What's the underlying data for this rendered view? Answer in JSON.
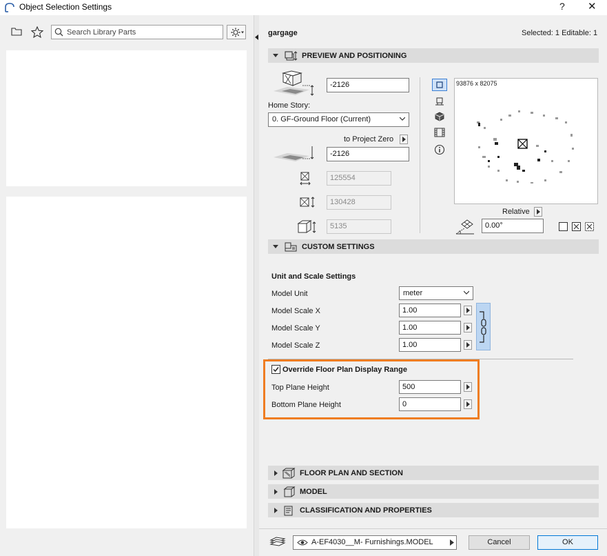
{
  "window": {
    "title": "Object Selection Settings",
    "help_glyph": "?",
    "close_glyph": "✕"
  },
  "library": {
    "search_placeholder": "Search Library Parts"
  },
  "header": {
    "object_name": "gargage",
    "selection_info": "Selected: 1 Editable: 1"
  },
  "preview_section": {
    "title": "PREVIEW AND POSITIONING",
    "elevation_value": "-2126",
    "home_story_label": "Home Story:",
    "home_story_value": "0. GF-Ground Floor (Current)",
    "to_project_zero_label": "to Project Zero",
    "project_zero_value": "-2126",
    "width_value": "125554",
    "depth_value": "130428",
    "height_value": "5135",
    "preview_size": "93876 x 82075",
    "relative_label": "Relative",
    "rotation_value": "0.00°"
  },
  "custom_section": {
    "title": "CUSTOM SETTINGS",
    "group_title": "Unit and Scale Settings",
    "model_unit_label": "Model Unit",
    "model_unit_value": "meter",
    "scale_x_label": "Model Scale X",
    "scale_x_value": "1.00",
    "scale_y_label": "Model Scale Y",
    "scale_y_value": "1.00",
    "scale_z_label": "Model Scale Z",
    "scale_z_value": "1.00",
    "override_label": "Override Floor Plan Display Range",
    "override_checked": true,
    "top_plane_label": "Top Plane Height",
    "top_plane_value": "500",
    "bottom_plane_label": "Bottom Plane Height",
    "bottom_plane_value": "0"
  },
  "collapsed_sections": {
    "floor_plan": "FLOOR PLAN AND SECTION",
    "model": "MODEL",
    "classification": "CLASSIFICATION AND PROPERTIES"
  },
  "footer": {
    "layer_value": "A-EF4030__M- Furnishings.MODEL",
    "cancel_label": "Cancel",
    "ok_label": "OK"
  },
  "colors": {
    "highlight_box": "#ef7d22",
    "active_blue": "#3b7fd4"
  }
}
